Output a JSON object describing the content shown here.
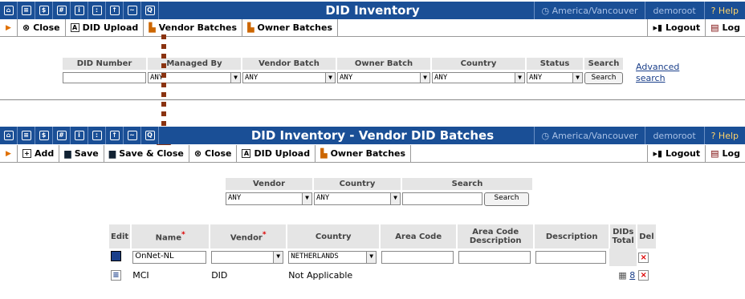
{
  "top": {
    "title": "DID Inventory",
    "timezone": "America/Vancouver",
    "user": "demoroot",
    "help": "Help",
    "toolbar": {
      "close": "Close",
      "did_upload": "DID Upload",
      "vendor_batches": "Vendor Batches",
      "owner_batches": "Owner Batches",
      "logout": "Logout",
      "log": "Log"
    },
    "filters": {
      "headers": [
        "DID Number",
        "Managed By",
        "Vendor Batch",
        "Owner Batch",
        "Country",
        "Status",
        "Search"
      ],
      "managed_by": "ANY",
      "vendor_batch": "ANY",
      "owner_batch": "ANY",
      "country": "ANY",
      "status": "ANY",
      "search_button": "Search",
      "advanced_link_1": "Advanced",
      "advanced_link_2": "search"
    }
  },
  "bottom": {
    "title": "DID Inventory - Vendor DID Batches",
    "timezone": "America/Vancouver",
    "user": "demoroot",
    "help": "Help",
    "toolbar": {
      "add": "Add",
      "save": "Save",
      "save_close": "Save & Close",
      "close": "Close",
      "did_upload": "DID Upload",
      "owner_batches": "Owner Batches",
      "logout": "Logout",
      "log": "Log"
    },
    "filters": {
      "headers": [
        "Vendor",
        "Country",
        "Search"
      ],
      "vendor": "ANY",
      "country": "ANY",
      "search_button": "Search"
    },
    "table": {
      "headers": [
        "Edit",
        "Name",
        "Vendor",
        "Country",
        "Area Code",
        "Area Code Description",
        "Description",
        "DIDs Total",
        "Del"
      ],
      "edit_row": {
        "name": "OnNet-NL",
        "vendor": "",
        "country": "NETHERLANDS"
      },
      "row": {
        "name": "MCI",
        "vendor": "DID",
        "country": "Not Applicable",
        "dids_total": "8"
      }
    }
  }
}
